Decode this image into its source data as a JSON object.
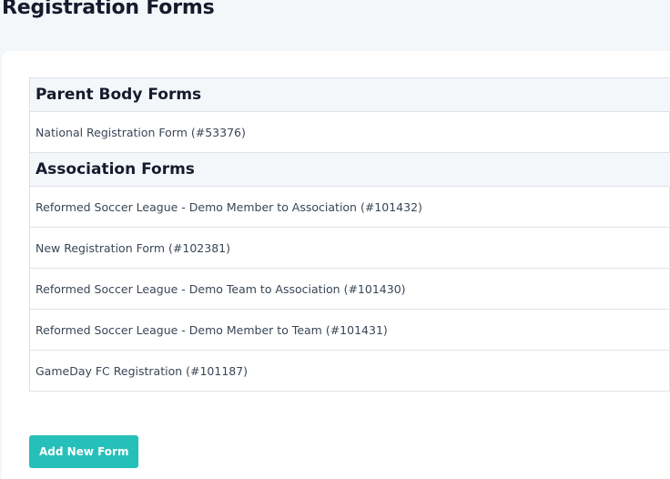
{
  "page": {
    "title": "Registration Forms"
  },
  "sections": [
    {
      "title": "Parent Body Forms",
      "forms": [
        "National Registration Form (#53376)"
      ]
    },
    {
      "title": "Association Forms",
      "forms": [
        "Reformed Soccer League - Demo Member to Association (#101432)",
        "New Registration Form (#102381)",
        "Reformed Soccer League - Demo Team to Association (#101430)",
        "Reformed Soccer League - Demo Member to Team (#101431)",
        "GameDay FC Registration (#101187)"
      ]
    }
  ],
  "actions": {
    "add_form_label": "Add New Form"
  },
  "colors": {
    "accent": "#25c0b9",
    "background": "#f4f7fa",
    "border": "#dde3ea"
  }
}
